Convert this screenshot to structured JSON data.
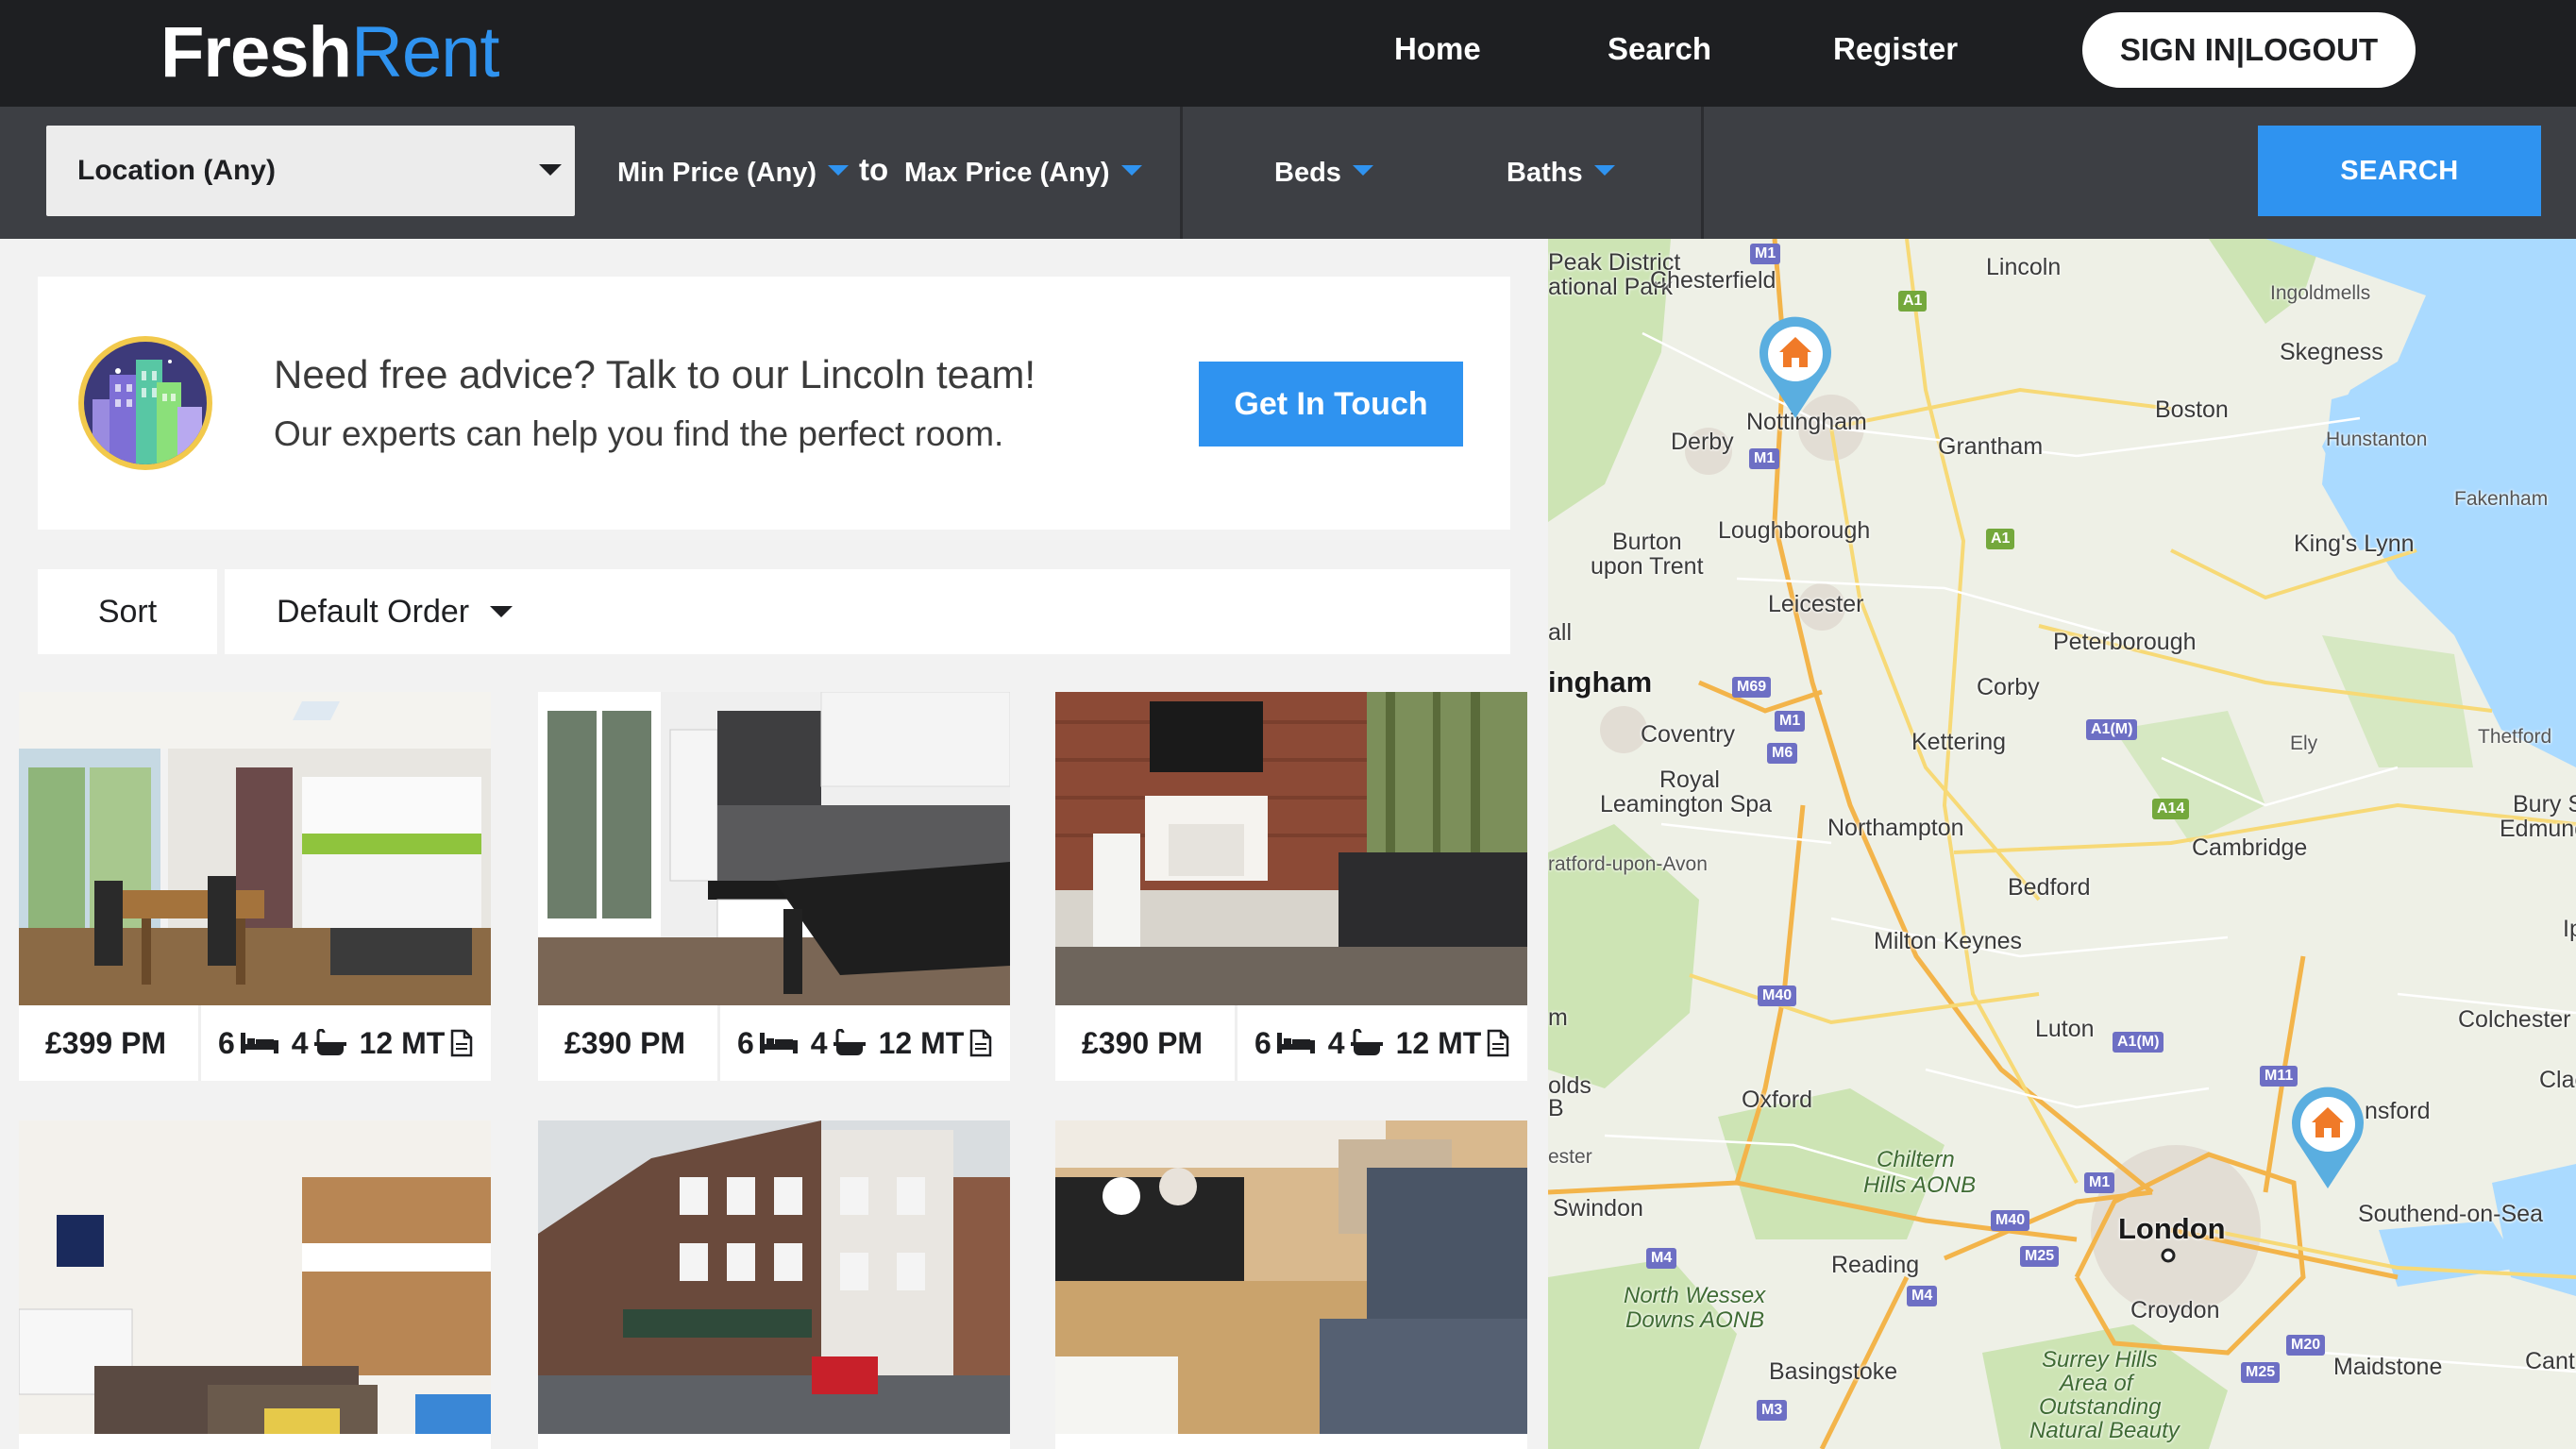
{
  "brand": {
    "fresh": "Fresh",
    "rent": "Rent"
  },
  "nav": {
    "home": "Home",
    "search": "Search",
    "register": "Register",
    "signin": "SIGN IN|LOGOUT"
  },
  "filters": {
    "location": "Location (Any)",
    "min_price": "Min Price (Any)",
    "to": "to",
    "max_price": "Max Price (Any)",
    "beds": "Beds",
    "baths": "Baths",
    "search": "SEARCH"
  },
  "advice": {
    "title": "Need free advice? Talk to our Lincoln team!",
    "subtitle": "Our experts can help you find the perfect room.",
    "button": "Get In Touch"
  },
  "sort": {
    "label": "Sort",
    "value": "Default Order"
  },
  "listings": [
    {
      "price": "£399 PM",
      "beds": "6",
      "baths": "4",
      "term": "12 MT",
      "photo": "kitchen-diner"
    },
    {
      "price": "£390 PM",
      "beds": "6",
      "baths": "4",
      "term": "12 MT",
      "photo": "kitchen"
    },
    {
      "price": "£390 PM",
      "beds": "6",
      "baths": "4",
      "term": "12 MT",
      "photo": "living-room"
    },
    {
      "photo": "open-plan-lounge"
    },
    {
      "photo": "brick-building"
    },
    {
      "photo": "lounge-sofas"
    }
  ],
  "map": {
    "places": [
      "Peak District",
      "ational Park",
      "Chesterfield",
      "Lincoln",
      "Ingoldmells",
      "Skegness",
      "Nottingham",
      "Derby",
      "Boston",
      "Grantham",
      "Hunstanton",
      "Fakenham",
      "Burton",
      "upon Trent",
      "Loughborough",
      "King's Lynn",
      "Leicester",
      "all",
      "Peterborough",
      "ingham",
      "Corby",
      "Coventry",
      "Kettering",
      "Ely",
      "Thetford",
      "Royal",
      "Leamington Spa",
      "Bury St",
      "Edmunds",
      "Northampton",
      "ratford-upon-Avon",
      "Cambridge",
      "Bedford",
      "Milton Keynes",
      "Ip",
      "m",
      "Luton",
      "Colchester",
      "olds",
      "B",
      "Oxford",
      "Clac",
      "nsford",
      "ester",
      "Chiltern",
      "Hills AONB",
      "Swindon",
      "London",
      "Southend-on-Sea",
      "Reading",
      "North Wessex",
      "Downs AONB",
      "Croydon",
      "Basingstoke",
      "Surrey Hills",
      "Area of",
      "Outstanding",
      "Natural Beauty",
      "Maidstone",
      "Cant"
    ],
    "roads": [
      "M1",
      "A1",
      "M1",
      "A1",
      "M69",
      "M1",
      "M6",
      "A1(M)",
      "A14",
      "M40",
      "A1(M)",
      "M11",
      "M1",
      "M40",
      "M25",
      "M4",
      "M4",
      "M20",
      "M25",
      "M3"
    ]
  }
}
